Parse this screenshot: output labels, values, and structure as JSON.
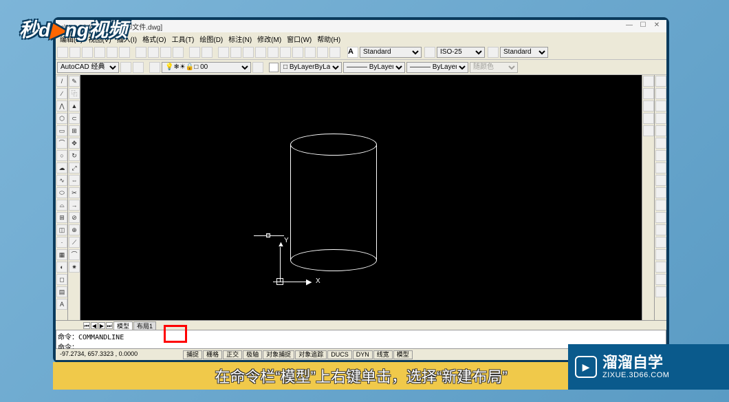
{
  "window": {
    "title_path": "rs\\Kur-Dia\\Desktop\\打印文件.dwg]",
    "min": "—",
    "max": "☐",
    "close": "✕"
  },
  "menu": {
    "items": [
      "编辑(E)",
      "视图(V)",
      "插入(I)",
      "格式(O)",
      "工具(T)",
      "绘图(D)",
      "标注(N)",
      "修改(M)",
      "窗口(W)",
      "帮助(H)"
    ]
  },
  "styles": {
    "text_style": "Standard",
    "dim_style": "ISO-25",
    "table_style": "Standard"
  },
  "workspace": {
    "name": "AutoCAD 经典",
    "layer": "0"
  },
  "props": {
    "color": "ByLayer",
    "linetype": "ByLayer",
    "lineweight": "ByLayer",
    "plotstyle": "随颜色"
  },
  "tabs": {
    "model": "模型",
    "layout1": "布局1"
  },
  "cmd": {
    "line1": "命令：COMMANDLINE",
    "line2": "命令："
  },
  "status": {
    "coords": "-97.2734,   657.3323 ,  0.0000",
    "btns": [
      "捕捉",
      "栅格",
      "正交",
      "极轴",
      "对象捕捉",
      "对象追踪",
      "DUCS",
      "DYN",
      "线宽",
      "模型"
    ]
  },
  "ucs": {
    "x": "X",
    "y": "Y"
  },
  "overlay": {
    "logo_tl": "秒d▶ng视频",
    "subtitle": "在命令栏“模型”上右键单击，选择“新建布局”",
    "brand": "溜溜自学",
    "brand_url": "ZIXUE.3D66.COM"
  }
}
